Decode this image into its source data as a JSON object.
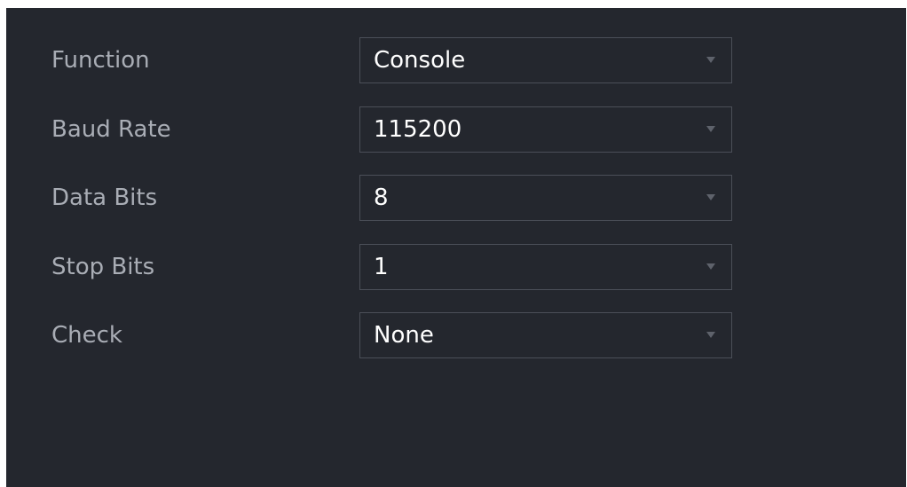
{
  "settings": {
    "rows": [
      {
        "label": "Function",
        "value": "Console"
      },
      {
        "label": "Baud Rate",
        "value": "115200"
      },
      {
        "label": "Data Bits",
        "value": "8"
      },
      {
        "label": "Stop Bits",
        "value": "1"
      },
      {
        "label": "Check",
        "value": "None"
      }
    ]
  },
  "icons": {
    "dropdown": "chevron-down-icon"
  },
  "colors": {
    "panel_background": "#24272e",
    "label_text": "#a9adb5",
    "value_text": "#ffffff",
    "field_border": "#4b4f58",
    "caret": "#5e626b"
  }
}
